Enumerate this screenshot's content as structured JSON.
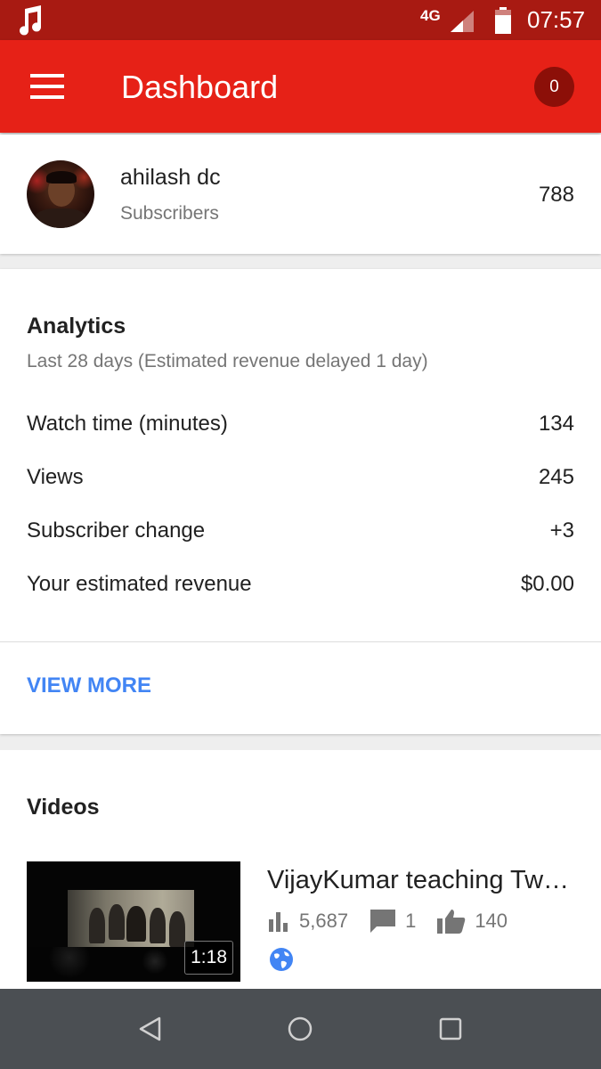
{
  "status_bar": {
    "network": "4G",
    "time": "07:57",
    "icons": [
      "music-icon",
      "signal-icon",
      "battery-icon"
    ]
  },
  "app_bar": {
    "title": "Dashboard",
    "notification_count": "0"
  },
  "profile": {
    "name": "ahilash dc",
    "subtitle": "Subscribers",
    "subscriber_count": "788"
  },
  "analytics": {
    "heading": "Analytics",
    "period": "Last 28 days (Estimated revenue delayed 1 day)",
    "rows": [
      {
        "label": "Watch time (minutes)",
        "value": "134"
      },
      {
        "label": "Views",
        "value": "245"
      },
      {
        "label": "Subscriber change",
        "value": "+3"
      },
      {
        "label": "Your estimated revenue",
        "value": "$0.00"
      }
    ],
    "view_more": "VIEW MORE"
  },
  "videos": {
    "heading": "Videos",
    "items": [
      {
        "title": "VijayKumar teaching Tw…",
        "duration": "1:18",
        "views": "5,687",
        "comments": "1",
        "likes": "140",
        "visibility_icon": "globe-icon"
      }
    ]
  },
  "colors": {
    "status_bar": "#a81a12",
    "app_bar": "#e62117",
    "badge": "#8c0f08",
    "link": "#4285f4",
    "nav_bar": "#4b4f53"
  },
  "nav_bar": {
    "icons": [
      "back-icon",
      "home-icon",
      "recents-icon"
    ]
  }
}
